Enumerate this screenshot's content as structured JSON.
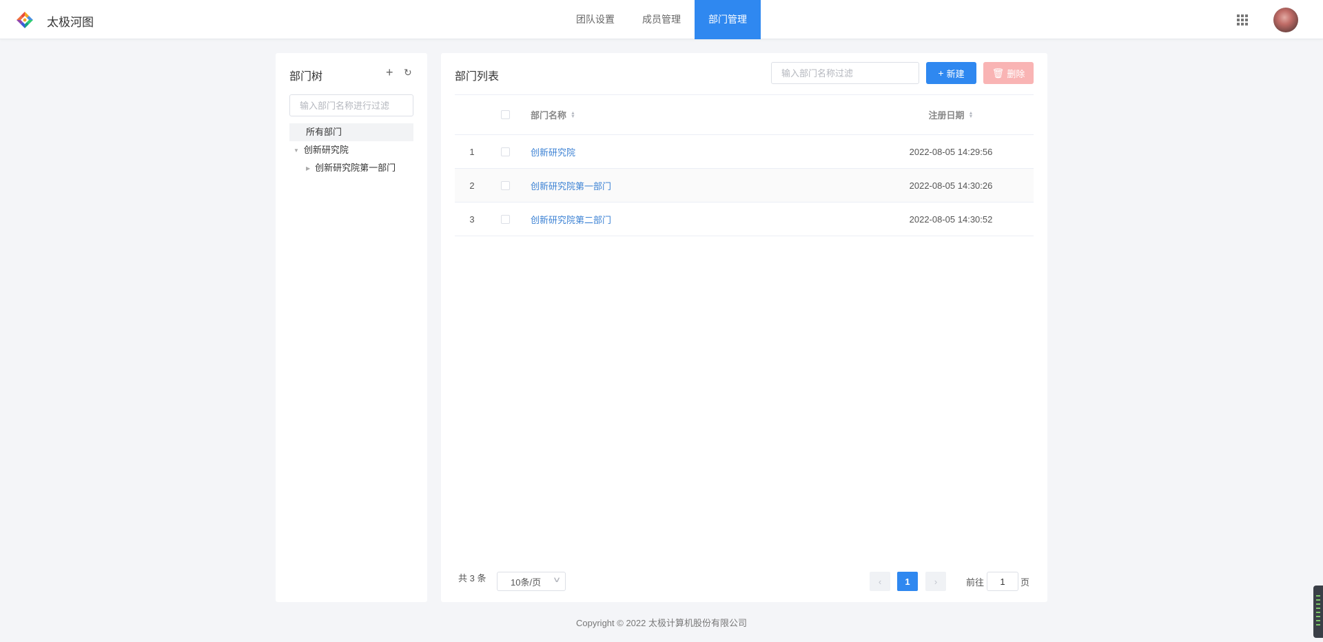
{
  "header": {
    "brand": "太极河图",
    "nav": [
      {
        "label": "团队设置"
      },
      {
        "label": "成员管理"
      },
      {
        "label": "部门管理",
        "active": true
      }
    ],
    "apps_icon": "grid-icon",
    "accent_color": "#2f88f0"
  },
  "tree": {
    "title": "部门树",
    "add_icon": "+",
    "refresh_icon": "↻",
    "filter_placeholder": "输入部门名称进行过滤",
    "nodes": [
      {
        "label": "所有部门",
        "selected": true
      },
      {
        "label": "创新研究院",
        "expanded": true
      },
      {
        "label": "创新研究院第一部门",
        "expanded": false
      }
    ]
  },
  "list": {
    "title": "部门列表",
    "filter_placeholder": "输入部门名称过滤",
    "new_label": "新建",
    "delete_label": "删除",
    "columns": {
      "name": "部门名称",
      "date": "注册日期"
    },
    "rows": [
      {
        "index": "1",
        "name": "创新研究院",
        "date": "2022-08-05 14:29:56"
      },
      {
        "index": "2",
        "name": "创新研究院第一部门",
        "date": "2022-08-05 14:30:26"
      },
      {
        "index": "3",
        "name": "创新研究院第二部门",
        "date": "2022-08-05 14:30:52"
      }
    ]
  },
  "pagination": {
    "total_text": "共 3 条",
    "page_size": "10条/页",
    "current_page": "1",
    "goto_prefix": "前往",
    "goto_value": "1",
    "goto_suffix": "页"
  },
  "footer": {
    "copyright": "Copyright © 2022 太极计算机股份有限公司"
  }
}
